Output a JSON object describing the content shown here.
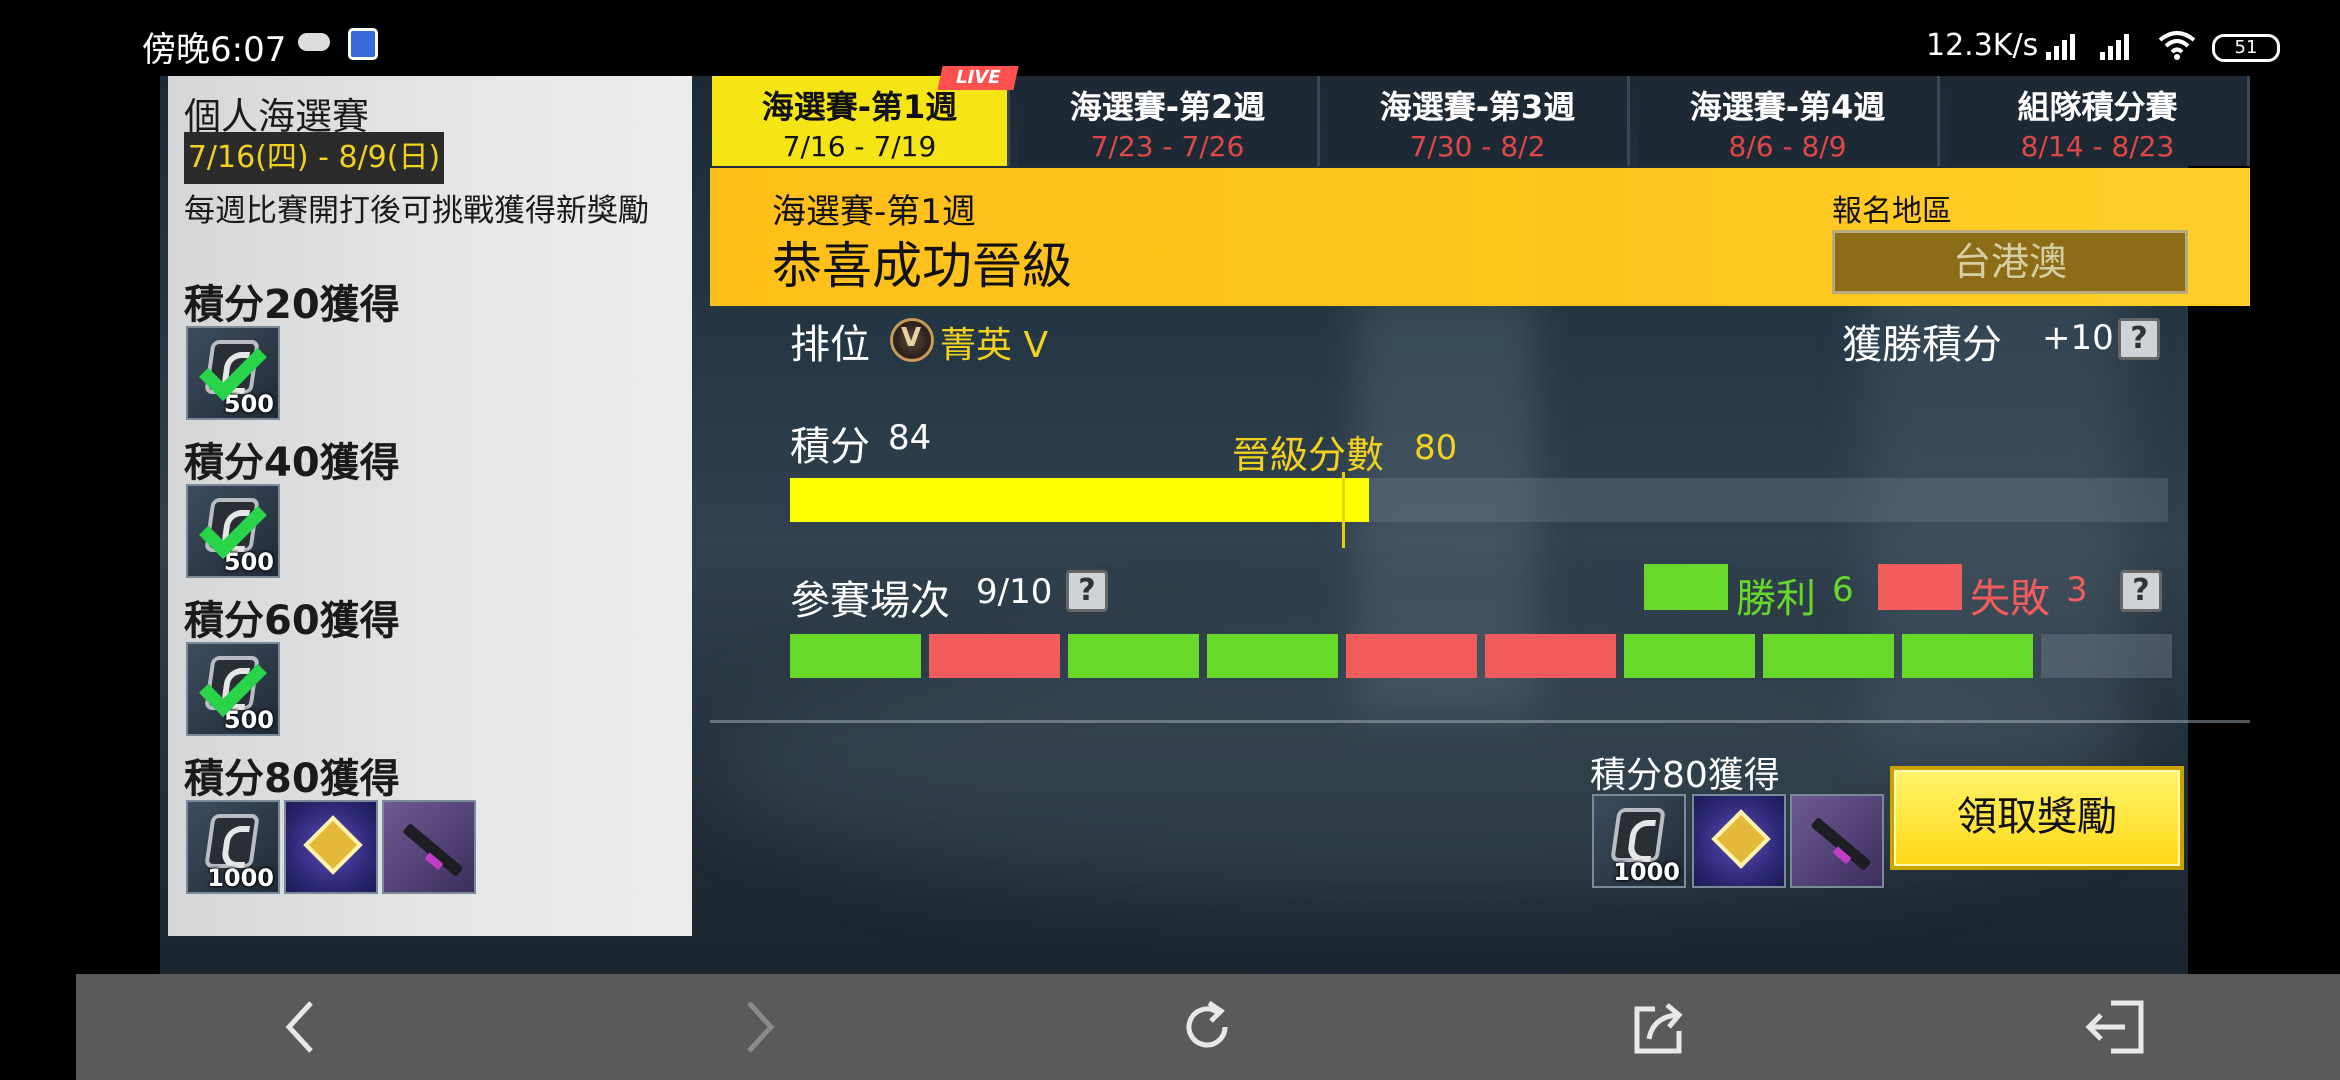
{
  "status_bar": {
    "time": "傍晚6:07",
    "net_speed": "12.3K/s",
    "battery": "51",
    "icons": [
      "cloud-icon",
      "app-notification-icon",
      "signal-icon",
      "signal-icon",
      "wifi-icon",
      "battery-icon"
    ]
  },
  "left_panel": {
    "title": "個人海選賽",
    "date_range": "7/16(四) - 8/9(日)",
    "description": "每週比賽開打後可挑戰獲得新獎勵",
    "tiers": [
      {
        "label": "積分20獲得",
        "reward": "500",
        "claimed": true
      },
      {
        "label": "積分40獲得",
        "reward": "500",
        "claimed": true
      },
      {
        "label": "積分60獲得",
        "reward": "500",
        "claimed": true
      },
      {
        "label": "積分80獲得",
        "rewards": [
          "1000",
          "badge",
          "weapon-skin"
        ],
        "claimed": false
      }
    ]
  },
  "tabs": [
    {
      "name": "海選賽-第1週",
      "date": "7/16 - 7/19",
      "active": true
    },
    {
      "name": "海選賽-第2週",
      "date": "7/23 - 7/26",
      "active": false
    },
    {
      "name": "海選賽-第3週",
      "date": "7/30 - 8/2",
      "active": false
    },
    {
      "name": "海選賽-第4週",
      "date": "8/6 - 8/9",
      "active": false
    },
    {
      "name": "組隊積分賽",
      "date": "8/14 - 8/23",
      "active": false
    }
  ],
  "live_badge": "LIVE",
  "banner": {
    "week": "海選賽-第1週",
    "status": "恭喜成功晉級",
    "region_label": "報名地區",
    "region": "台港澳"
  },
  "stats": {
    "rank_label": "排位",
    "rank_value": "菁英 V",
    "win_points_label": "獲勝積分",
    "win_points_value": "+10",
    "score_label": "積分",
    "score_value": "84",
    "promote_label": "晉級分數",
    "promote_value": "80",
    "score_fraction": 0.42,
    "matches_label": "參賽場次",
    "matches_value": "9/10",
    "wins_label": "勝利",
    "wins_value": "6",
    "losses_label": "失敗",
    "losses_value": "3",
    "match_results": [
      "win",
      "loss",
      "win",
      "win",
      "loss",
      "loss",
      "win",
      "win",
      "win",
      "none"
    ],
    "help_icon": "?"
  },
  "claim": {
    "label": "積分80獲得",
    "rewards": [
      "1000",
      "badge",
      "weapon-skin"
    ],
    "button": "領取獎勵"
  },
  "colors": {
    "accent_yellow": "#ffff00",
    "banner_yellow": "#ffc21c",
    "win_green": "#66d92b",
    "loss_red": "#f25c5c",
    "tab_date_red": "#e04848"
  },
  "nav_icons": [
    "back-arrow-icon",
    "forward-arrow-icon",
    "refresh-icon",
    "share-icon",
    "exit-icon"
  ]
}
